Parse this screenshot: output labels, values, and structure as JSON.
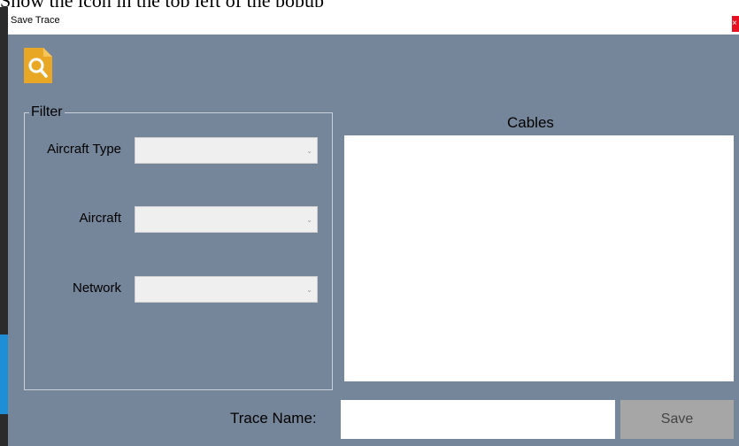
{
  "caption": "Show the icon in the top left of the popup",
  "window": {
    "title": "Save Trace",
    "close_symbol": "×",
    "logo_icon": "file-search-icon"
  },
  "filter": {
    "legend": "Filter",
    "aircraft_type_label": "Aircraft Type",
    "aircraft_type_value": "",
    "aircraft_label": "Aircraft",
    "aircraft_value": "",
    "network_label": "Network",
    "network_value": "",
    "dropdown_arrow": "⌄"
  },
  "cables": {
    "label": "Cables",
    "items": []
  },
  "trace": {
    "name_label": "Trace Name:",
    "name_value": "",
    "save_label": "Save"
  },
  "colors": {
    "window_bg": "#76869a",
    "logo": "#e8a825",
    "close": "#e81123"
  }
}
